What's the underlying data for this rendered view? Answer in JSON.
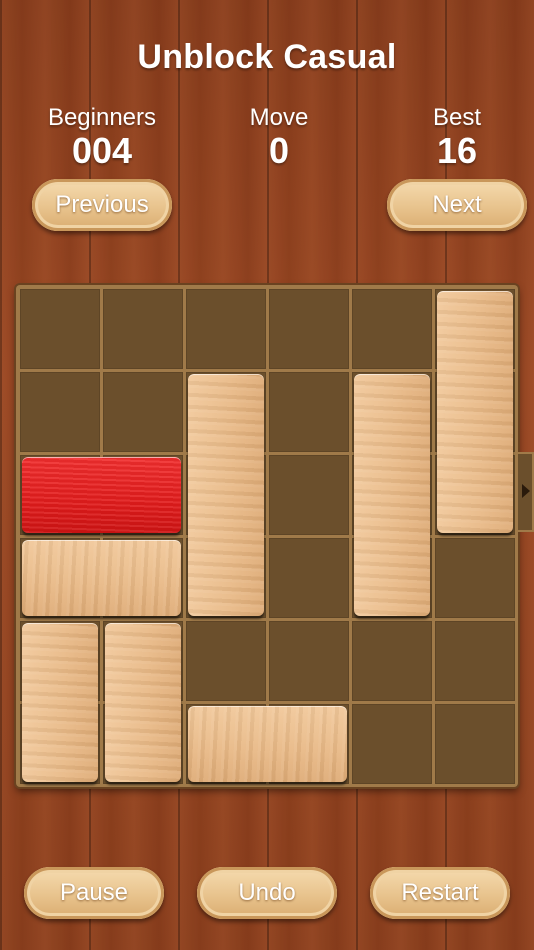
{
  "header": {
    "title": "Unblock Casual"
  },
  "stats": [
    {
      "label": "Beginners",
      "value": "004"
    },
    {
      "label": "Move",
      "value": "0"
    },
    {
      "label": "Best",
      "value": "16"
    }
  ],
  "nav": {
    "previous_label": "Previous",
    "next_label": "Next"
  },
  "controls": {
    "pause_label": "Pause",
    "undo_label": "Undo",
    "restart_label": "Restart"
  },
  "board": {
    "grid_size": 6,
    "exit_row": 2,
    "blocks": [
      {
        "name": "red-block",
        "kind": "target",
        "row": 2,
        "col": 0,
        "length": 2,
        "orientation": "horizontal",
        "color": "#e21e1e"
      },
      {
        "name": "wood-block",
        "kind": "wood",
        "row": 0,
        "col": 5,
        "length": 3,
        "orientation": "vertical"
      },
      {
        "name": "wood-block",
        "kind": "wood",
        "row": 1,
        "col": 2,
        "length": 3,
        "orientation": "vertical"
      },
      {
        "name": "wood-block",
        "kind": "wood",
        "row": 1,
        "col": 4,
        "length": 3,
        "orientation": "vertical"
      },
      {
        "name": "wood-block",
        "kind": "wood",
        "row": 3,
        "col": 0,
        "length": 2,
        "orientation": "horizontal"
      },
      {
        "name": "wood-block",
        "kind": "wood",
        "row": 4,
        "col": 0,
        "length": 2,
        "orientation": "vertical"
      },
      {
        "name": "wood-block",
        "kind": "wood",
        "row": 4,
        "col": 1,
        "length": 2,
        "orientation": "vertical"
      },
      {
        "name": "wood-block",
        "kind": "wood",
        "row": 5,
        "col": 2,
        "length": 2,
        "orientation": "horizontal"
      }
    ]
  },
  "icons": {
    "exit": "play-arrow-icon"
  }
}
